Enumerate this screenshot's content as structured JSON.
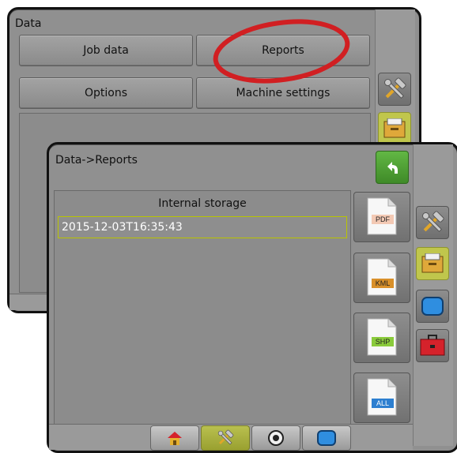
{
  "back_window": {
    "title": "Data",
    "buttons": [
      "Job data",
      "Reports",
      "Options",
      "Machine settings"
    ]
  },
  "front_window": {
    "title": "Data->Reports",
    "list_header": "Internal storage",
    "list_items": [
      "2015-12-03T16:35:43"
    ]
  },
  "file_buttons": [
    "PDF",
    "KML",
    "SHP",
    "ALL"
  ],
  "side_icons": [
    "tools-icon",
    "data-folder-icon",
    "screen-icon",
    "toolbox-icon"
  ],
  "bottom_icons": [
    "home-icon",
    "tools-icon",
    "camera-icon",
    "screen-icon"
  ],
  "colors": {
    "highlight_ring": "#d11f22",
    "active_tab": "#c0c64c",
    "back_arrow_button": "#56a83a",
    "pdf_label": "#f3c9b4",
    "kml_label": "#d9902a",
    "shp_label": "#8acb3b",
    "all_label": "#2d7fd0"
  }
}
